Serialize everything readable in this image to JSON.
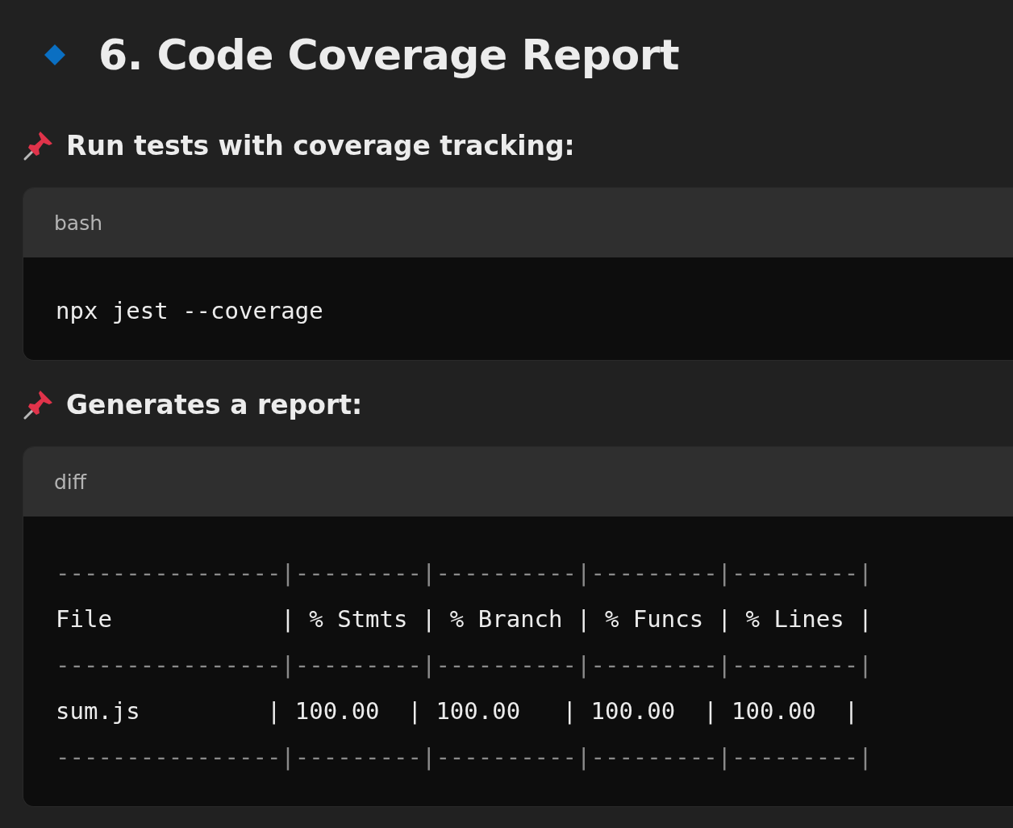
{
  "title": "6. Code Coverage Report",
  "sections": [
    {
      "heading": "Run tests with coverage tracking:",
      "code": {
        "language": "bash",
        "lines": [
          {
            "kind": "text",
            "text": "npx jest --coverage"
          }
        ]
      }
    },
    {
      "heading": "Generates a report:",
      "code": {
        "language": "diff",
        "lines": [
          {
            "kind": "rule",
            "text": "----------------|---------|----------|---------|---------|"
          },
          {
            "kind": "text",
            "text": "File            | % Stmts | % Branch | % Funcs | % Lines |"
          },
          {
            "kind": "rule",
            "text": "----------------|---------|----------|---------|---------|"
          },
          {
            "kind": "text",
            "text": "sum.js         | 100.00  | 100.00   | 100.00  | 100.00  |"
          },
          {
            "kind": "rule",
            "text": "----------------|---------|----------|---------|---------|"
          }
        ]
      }
    }
  ]
}
